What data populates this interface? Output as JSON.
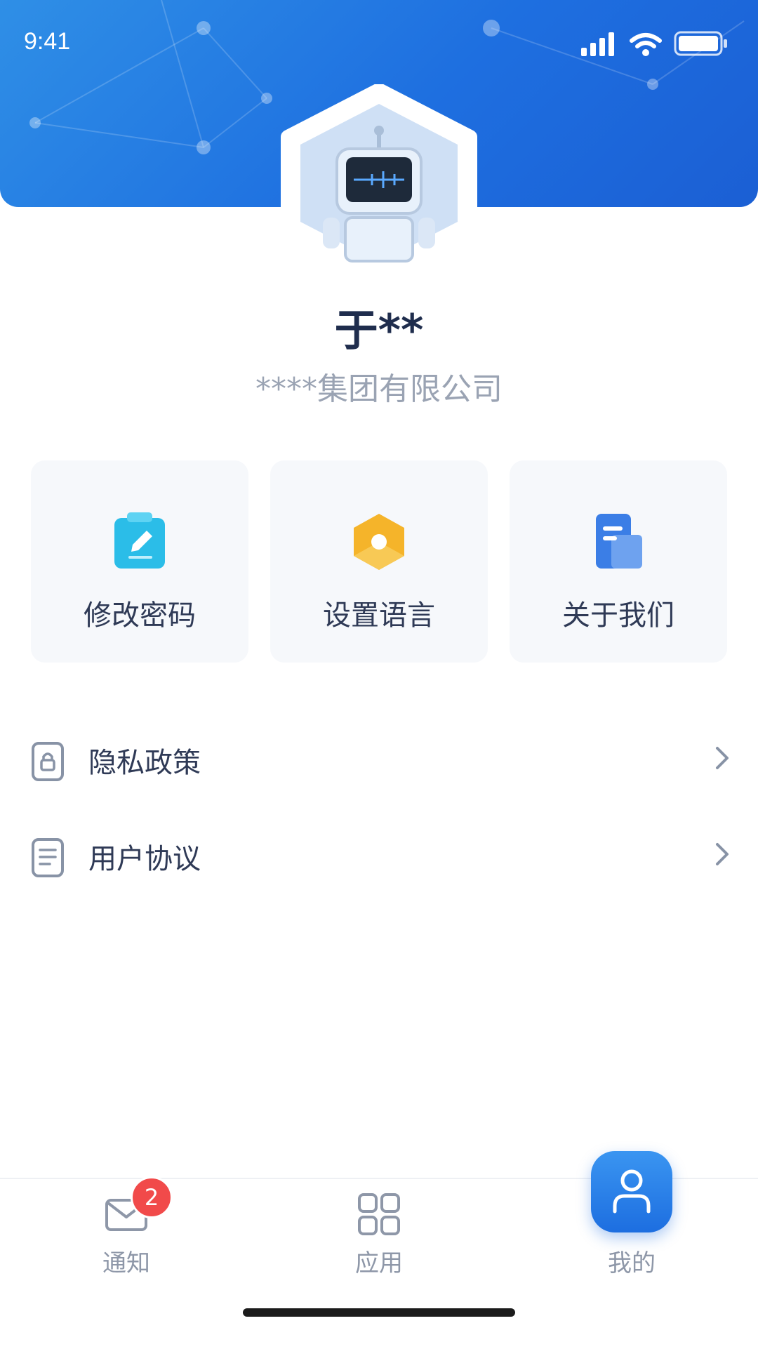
{
  "status_bar": {
    "time": "9:41"
  },
  "profile": {
    "name": "于**",
    "company": "****集团有限公司"
  },
  "quick_actions": [
    {
      "label": "修改密码",
      "icon": "edit-password-icon",
      "color": "#2bbde8"
    },
    {
      "label": "设置语言",
      "icon": "language-settings-icon",
      "color": "#f5b42a"
    },
    {
      "label": "关于我们",
      "icon": "about-us-icon",
      "color": "#3b7ee6"
    }
  ],
  "menu": [
    {
      "label": "隐私政策",
      "icon": "privacy-lock-icon"
    },
    {
      "label": "用户协议",
      "icon": "document-icon"
    }
  ],
  "tabbar": {
    "notify": {
      "label": "通知",
      "badge": "2"
    },
    "apps": {
      "label": "应用"
    },
    "mine": {
      "label": "我的"
    }
  },
  "colors": {
    "primary": "#1e6fe0",
    "badge": "#f14a4a"
  }
}
